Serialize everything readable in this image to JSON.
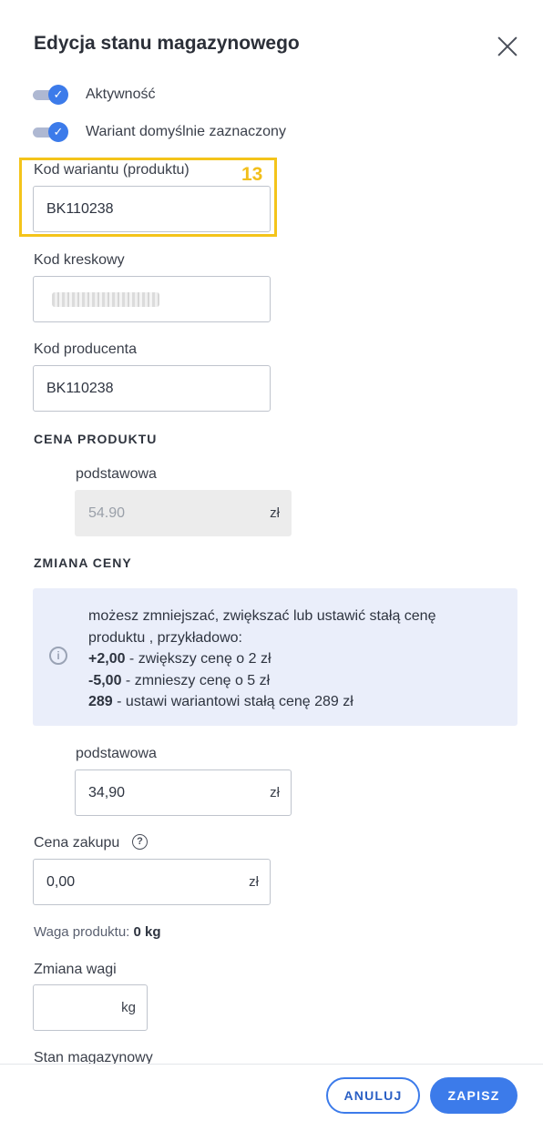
{
  "header": {
    "title": "Edycja stanu magazynowego"
  },
  "toggles": [
    {
      "label": "Aktywność",
      "checked": true
    },
    {
      "label": "Wariant domyślnie zaznaczony",
      "checked": true
    }
  ],
  "fields": {
    "variant_code": {
      "label": "Kod wariantu (produktu)",
      "value": "BK110238"
    },
    "barcode": {
      "label": "Kod kreskowy",
      "value": ""
    },
    "producer_code": {
      "label": "Kod producenta",
      "value": "BK110238"
    }
  },
  "annotation": {
    "number": "13",
    "color": "#f4c41a"
  },
  "price": {
    "section_title": "CENA PRODUKTU",
    "sub_label": "podstawowa",
    "value": "54.90",
    "currency": "zł"
  },
  "price_change": {
    "section_title": "ZMIANA CENY",
    "info": {
      "line1": "możesz zmniejszać, zwiększać lub ustawić stałą cenę",
      "line2": "produktu , przykładowo:",
      "ex1_bold": "+2,00",
      "ex1_text": " - zwiększy cenę o 2 zł",
      "ex2_bold": "-5,00",
      "ex2_text": " - zmniesz​y cenę o 5 zł",
      "ex3_bold": "289",
      "ex3_text": " - ustawi wariantowi stałą cenę 289 zł"
    },
    "sub_label": "podstawowa",
    "value": "34,90",
    "currency": "zł"
  },
  "purchase": {
    "label": "Cena zakupu",
    "value": "0,00",
    "currency": "zł"
  },
  "weight": {
    "label": "Waga produktu:",
    "value": "0 kg"
  },
  "weight_change": {
    "label": "Zmiana wagi",
    "value": "",
    "unit": "kg"
  },
  "stock": {
    "label": "Stan magazynowy"
  },
  "footer": {
    "cancel_label": "ANULUJ",
    "save_label": "ZAPISZ"
  },
  "colors": {
    "accent": "#3c7bea",
    "highlight": "#f4c41a",
    "info_bg": "#eaeefa"
  }
}
